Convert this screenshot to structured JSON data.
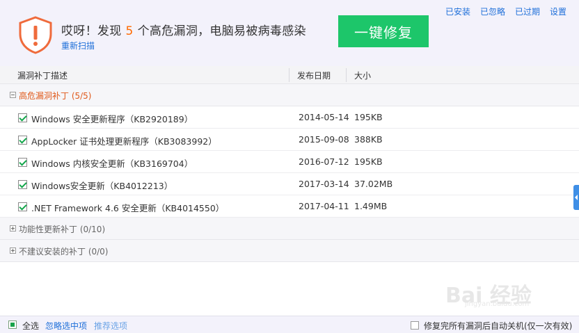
{
  "header": {
    "alert_prefix": "哎呀！发现",
    "alert_count": "5",
    "alert_suffix": "个高危漏洞，电脑易被病毒感染",
    "rescan_label": "重新扫描",
    "fix_button_label": "一键修复",
    "links": [
      "已安装",
      "已忽略",
      "已过期",
      "设置"
    ]
  },
  "columns": {
    "desc": "漏洞补丁描述",
    "date": "发布日期",
    "size": "大小"
  },
  "groups": [
    {
      "label": "高危漏洞补丁 (5/5)",
      "expanded": true,
      "items": [
        {
          "name": "Windows 安全更新程序（KB2920189）",
          "date": "2014-05-14",
          "size": "195KB",
          "checked": true
        },
        {
          "name": "AppLocker 证书处理更新程序（KB3083992）",
          "date": "2015-09-08",
          "size": "388KB",
          "checked": true
        },
        {
          "name": "Windows 内核安全更新（KB3169704）",
          "date": "2016-07-12",
          "size": "195KB",
          "checked": true
        },
        {
          "name": "Windows安全更新（KB4012213）",
          "date": "2017-03-14",
          "size": "37.02MB",
          "checked": true
        },
        {
          "name": ".NET Framework 4.6 安全更新（KB4014550）",
          "date": "2017-04-11",
          "size": "1.49MB",
          "checked": true
        }
      ]
    },
    {
      "label": "功能性更新补丁 (0/10)",
      "expanded": false,
      "items": []
    },
    {
      "label": "不建议安装的补丁 (0/0)",
      "expanded": false,
      "items": []
    }
  ],
  "footer": {
    "select_all_label": "全选",
    "ignore_selected_label": "忽略选中项",
    "recommend_label": "推荐选项",
    "auto_shutdown_label": "修复完所有漏洞后自动关机(仅一次有效)"
  },
  "watermark": {
    "logo_text": "Bai 经验",
    "url": "jingyan.baidu.com"
  },
  "colors": {
    "accent_green": "#1dc66a",
    "alert_orange": "#ff6a00",
    "link_blue": "#1e6fd9",
    "shield_red": "#ef6b3c"
  }
}
